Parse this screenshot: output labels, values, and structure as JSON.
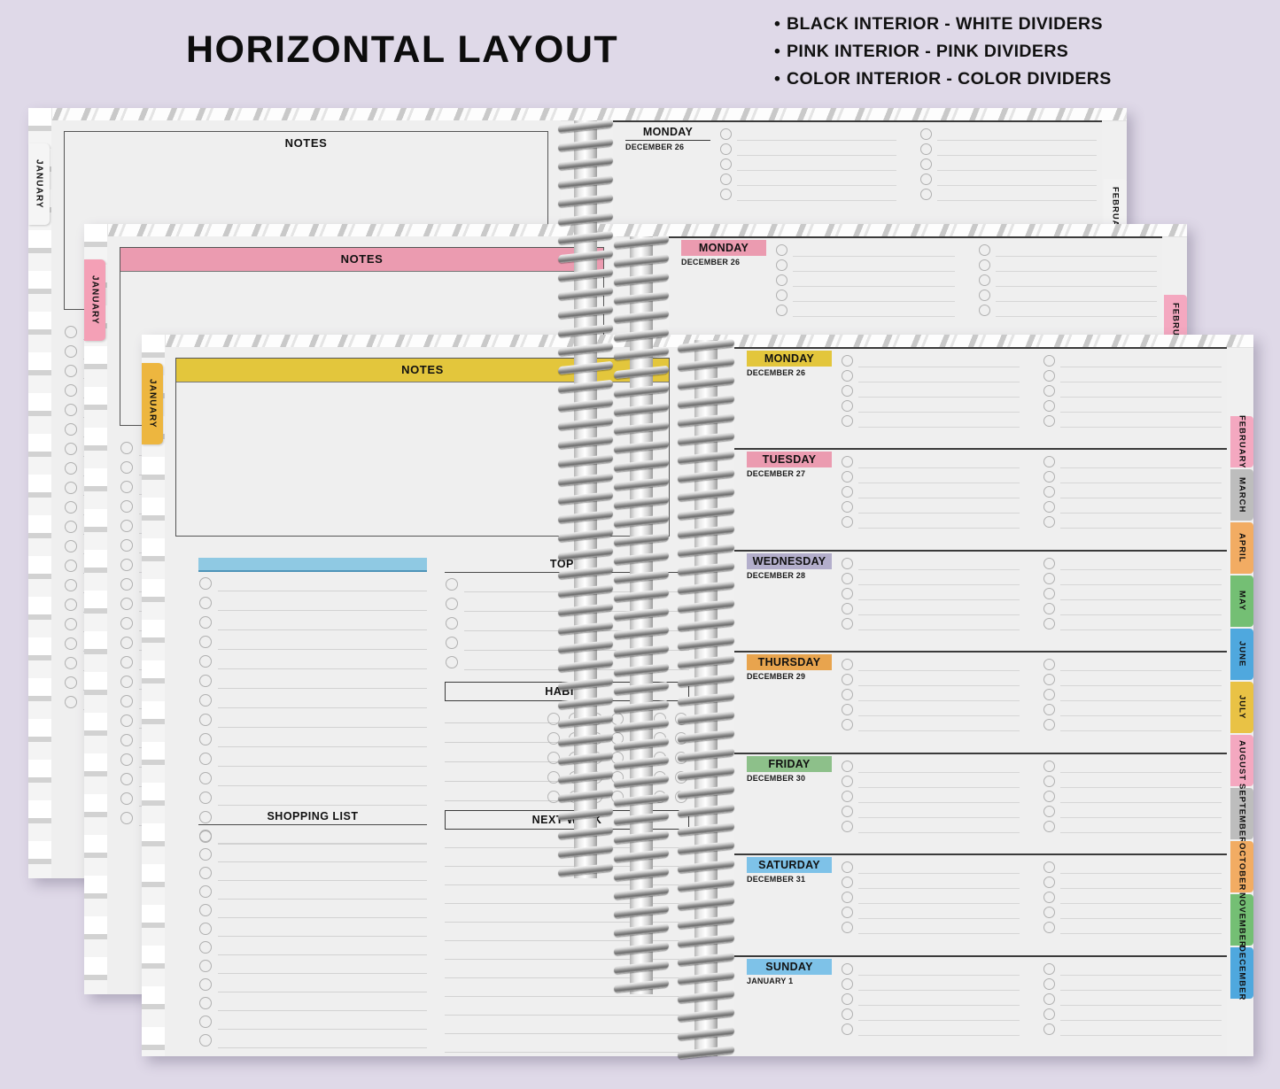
{
  "header": {
    "title": "HORIZONTAL LAYOUT",
    "features": [
      "BLACK INTERIOR - WHITE DIVIDERS",
      "PINK INTERIOR - PINK DIVIDERS",
      "COLOR INTERIOR - COLOR DIVIDERS"
    ],
    "bullet": "•"
  },
  "labels": {
    "notes": "NOTES",
    "top5": "TOP 5",
    "habits": "HABITS",
    "shopping_list": "SHOPPING LIST",
    "next_week": "NEXT WEEK",
    "january": "JANUARY",
    "february_partial": "FEBRUA"
  },
  "colors": {
    "background": "#dfd9e8",
    "paper": "#efefef",
    "yellow": "#e3c63c",
    "pink": "#eb9bb0",
    "lavender": "#b3aecb",
    "orange": "#e9a košt",
    "orange_fix": "#e8a44e",
    "green": "#8dc08a",
    "blue": "#8fc9e3",
    "gray": "#bdbdbd",
    "white": "#ffffff",
    "ink": "#111111"
  },
  "variants": [
    {
      "id": "black-interior",
      "name": "BLACK INTERIOR - WHITE DIVIDERS",
      "accent": "#ffffff",
      "accent_mode": "none",
      "tab_color": "#f2f2f2"
    },
    {
      "id": "pink-interior",
      "name": "PINK INTERIOR - PINK DIVIDERS",
      "accent": "#eb9bb0",
      "accent_mode": "fill",
      "tab_color": "#f4a0b6"
    },
    {
      "id": "color-interior",
      "name": "COLOR INTERIOR - COLOR DIVIDERS",
      "accent": "#e3c63c",
      "accent_mode": "fill",
      "tab_color": "#edb63f"
    }
  ],
  "days": [
    {
      "name": "MONDAY",
      "date": "DECEMBER 26",
      "color": "#e3c63c",
      "checks_per_col": 5,
      "cols": 2
    },
    {
      "name": "TUESDAY",
      "date": "DECEMBER 27",
      "color": "#eb9bb0",
      "checks_per_col": 5,
      "cols": 2
    },
    {
      "name": "WEDNESDAY",
      "date": "DECEMBER 28",
      "color": "#b3aecb",
      "checks_per_col": 5,
      "cols": 2
    },
    {
      "name": "THURSDAY",
      "date": "DECEMBER 29",
      "color": "#e8a44e",
      "checks_per_col": 5,
      "cols": 2
    },
    {
      "name": "FRIDAY",
      "date": "DECEMBER 30",
      "color": "#8dc08a",
      "checks_per_col": 5,
      "cols": 2
    },
    {
      "name": "SATURDAY",
      "date": "DECEMBER 31",
      "color": "#7ec2e8",
      "checks_per_col": 5,
      "cols": 2
    },
    {
      "name": "SUNDAY",
      "date": "JANUARY 1",
      "color": "#7ec2e8",
      "checks_per_col": 5,
      "cols": 2
    }
  ],
  "month_tabs": [
    {
      "label": "FEBRUARY",
      "color": "#f4a8c0"
    },
    {
      "label": "MARCH",
      "color": "#bdbdbd"
    },
    {
      "label": "APRIL",
      "color": "#f2ac63"
    },
    {
      "label": "MAY",
      "color": "#74bf74"
    },
    {
      "label": "JUNE",
      "color": "#4fa8de"
    },
    {
      "label": "JULY",
      "color": "#e9c245"
    },
    {
      "label": "AUGUST",
      "color": "#f4a8c0"
    },
    {
      "label": "SEPTEMBER",
      "color": "#bdbdbd"
    },
    {
      "label": "OCTOBER",
      "color": "#f2ac63"
    },
    {
      "label": "NOVEMBER",
      "color": "#74bf74"
    },
    {
      "label": "DECEMBER",
      "color": "#4fa8de"
    }
  ],
  "left_page": {
    "notes_rows": 0,
    "tasks_rows": 14,
    "top5_rows": 5,
    "habits_rows": 5,
    "habits_dots_per_row": 7,
    "shopping_rows": 12,
    "next_week_rows": 12
  }
}
